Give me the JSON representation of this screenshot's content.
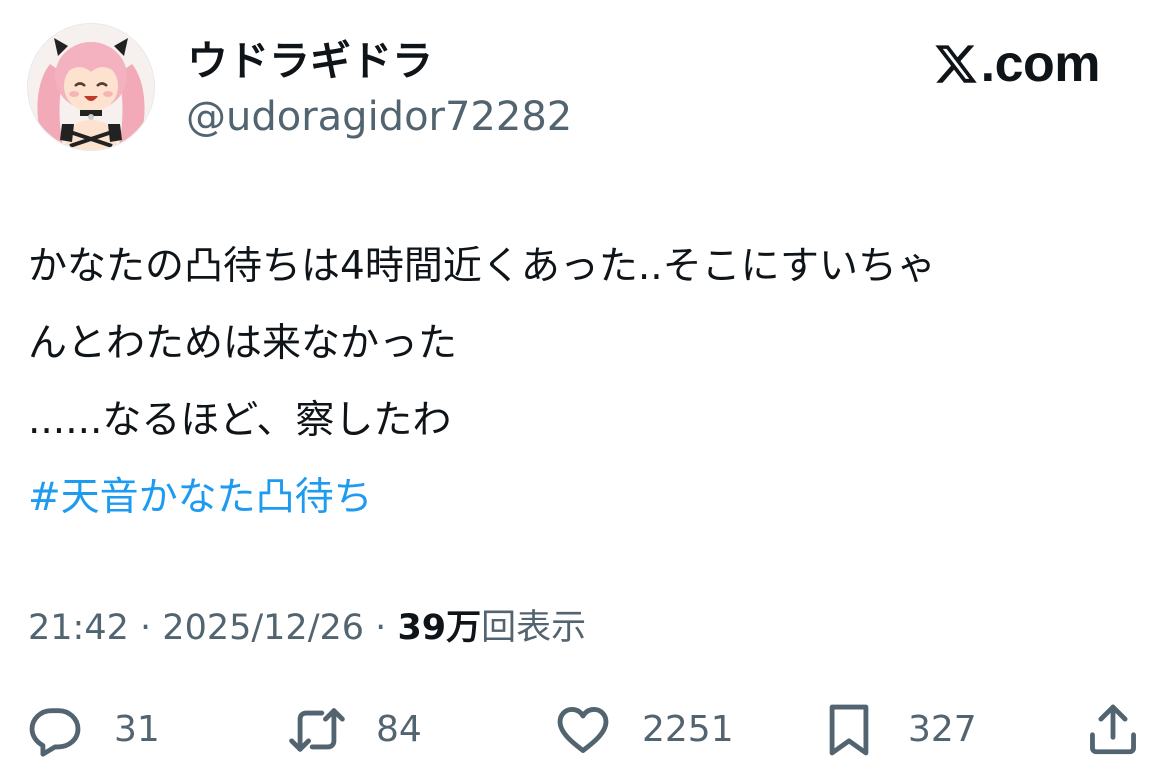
{
  "user": {
    "display_name": "ウドラギドラ",
    "handle": "@udoragidor72282",
    "avatar_icon": "pink-twintail-girl-avatar"
  },
  "brand": {
    "logo_icon": "x-logo-icon",
    "text": ".com"
  },
  "tweet": {
    "lines": [
      "かなたの凸待ちは4時間近くあった..そこにすいちゃ",
      "んとわためは来なかった",
      "......なるほど、察したわ"
    ],
    "hashtag": "#天音かなた凸待ち"
  },
  "meta": {
    "time": "21:42",
    "separator": "·",
    "date": "2025/12/26",
    "views_count": "39万",
    "views_label": "回表示"
  },
  "actions": {
    "reply": {
      "icon": "reply-icon",
      "count": "31"
    },
    "retweet": {
      "icon": "retweet-icon",
      "count": "84"
    },
    "like": {
      "icon": "heart-icon",
      "count": "2251"
    },
    "bookmark": {
      "icon": "bookmark-icon",
      "count": "327"
    },
    "share": {
      "icon": "share-icon"
    }
  },
  "colors": {
    "text": "#0f1419",
    "secondary": "#536471",
    "link": "#1d9bf0",
    "background": "#ffffff"
  }
}
